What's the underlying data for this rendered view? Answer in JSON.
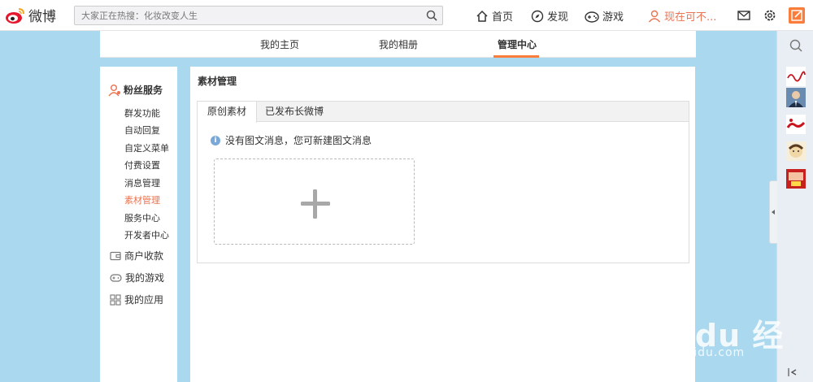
{
  "brand": {
    "name": "微博",
    "accent": "#eb7350"
  },
  "search": {
    "placeholder": "大家正在热搜：化妆改变人生"
  },
  "topnav": {
    "home": "首页",
    "discover": "发现",
    "games": "游戏",
    "user": "现在可不..."
  },
  "profile_tabs": [
    {
      "label": "我的主页",
      "active": false
    },
    {
      "label": "我的相册",
      "active": false
    },
    {
      "label": "管理中心",
      "active": true
    }
  ],
  "sidebar": {
    "fans_service": "粉丝服务",
    "items": [
      {
        "label": "群发功能",
        "active": false
      },
      {
        "label": "自动回复",
        "active": false
      },
      {
        "label": "自定义菜单",
        "active": false
      },
      {
        "label": "付费设置",
        "active": false
      },
      {
        "label": "消息管理",
        "active": false
      },
      {
        "label": "素材管理",
        "active": true
      },
      {
        "label": "服务中心",
        "active": false
      },
      {
        "label": "开发者中心",
        "active": false
      }
    ],
    "merchant": "商户收款",
    "my_games": "我的游戏",
    "my_apps": "我的应用"
  },
  "main": {
    "title": "素材管理",
    "tabs": [
      {
        "label": "原创素材",
        "active": true
      },
      {
        "label": "已发布长微博",
        "active": false
      }
    ],
    "notice": "没有图文消息，您可新建图文消息"
  },
  "watermark": {
    "logo": "Bai du 经验",
    "url": "jingyan.baidu.com"
  }
}
